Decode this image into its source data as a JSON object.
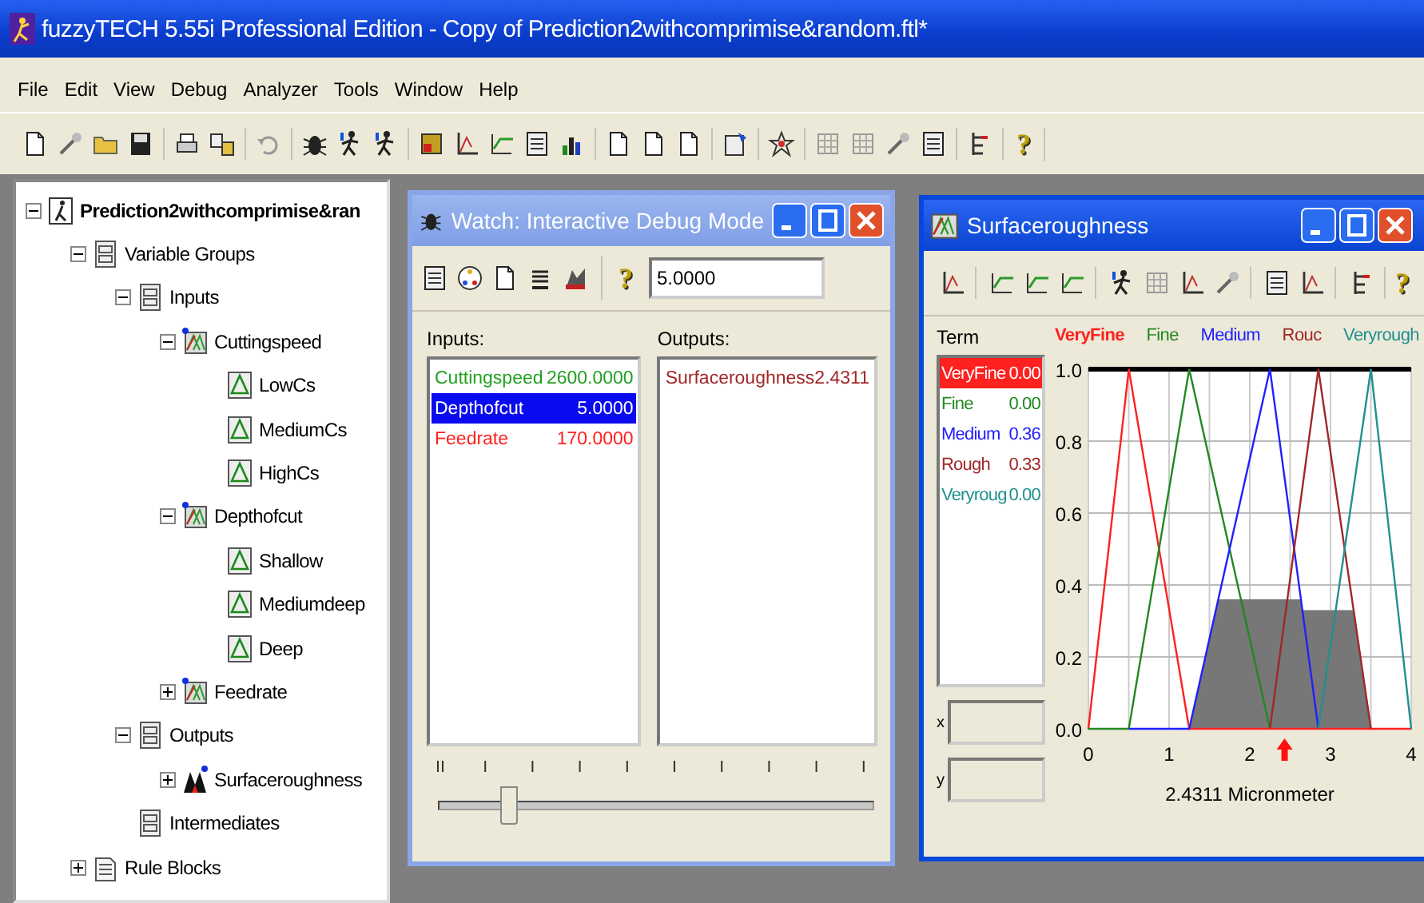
{
  "window": {
    "title": "fuzzyTECH 5.55i Professional Edition - Copy of Prediction2withcomprimise&random.ftl*"
  },
  "menu": [
    "File",
    "Edit",
    "View",
    "Debug",
    "Analyzer",
    "Tools",
    "Window",
    "Help"
  ],
  "toolbar": {
    "help": "?"
  },
  "tree": [
    {
      "label": "Prediction2withcomprimise&ran",
      "kind": "project",
      "expanded": true,
      "children": [
        {
          "label": "Variable Groups",
          "kind": "group",
          "expanded": true,
          "children": [
            {
              "label": "Inputs",
              "kind": "group",
              "expanded": true,
              "children": [
                {
                  "label": "Cuttingspeed",
                  "kind": "input",
                  "expanded": true,
                  "children": [
                    {
                      "label": "LowCs",
                      "kind": "term"
                    },
                    {
                      "label": "MediumCs",
                      "kind": "term"
                    },
                    {
                      "label": "HighCs",
                      "kind": "term"
                    }
                  ]
                },
                {
                  "label": "Depthofcut",
                  "kind": "input",
                  "expanded": true,
                  "children": [
                    {
                      "label": "Shallow",
                      "kind": "term"
                    },
                    {
                      "label": "Mediumdeep",
                      "kind": "term"
                    },
                    {
                      "label": "Deep",
                      "kind": "term"
                    }
                  ]
                },
                {
                  "label": "Feedrate",
                  "kind": "input",
                  "expanded": false
                }
              ]
            },
            {
              "label": "Outputs",
              "kind": "group",
              "expanded": true,
              "children": [
                {
                  "label": "Surfaceroughness",
                  "kind": "output",
                  "expanded": false
                }
              ]
            },
            {
              "label": "Intermediates",
              "kind": "group"
            }
          ]
        },
        {
          "label": "Rule Blocks",
          "kind": "rules",
          "expanded": false
        }
      ]
    }
  ],
  "watch": {
    "title": "Watch: Interactive Debug Mode",
    "help": "?",
    "value": "5.0000",
    "inputs_label": "Inputs:",
    "outputs_label": "Outputs:",
    "inputs": [
      {
        "name": "Cuttingspeed",
        "value": "2600.0000",
        "color": "#22a022",
        "selected": false
      },
      {
        "name": "Depthofcut",
        "value": "5.0000",
        "selected": true
      },
      {
        "name": "Feedrate",
        "value": "170.0000",
        "color": "#ff2020",
        "selected": false
      }
    ],
    "outputs": [
      {
        "name": "Surfaceroughness",
        "value": "2.4311",
        "color": "#a02828",
        "selected": false
      }
    ],
    "slider": {
      "level": 0.14
    }
  },
  "surface": {
    "title": "Surfaceroughness",
    "help": "?",
    "term_label": "Term",
    "x_label": "x",
    "y_label": "y",
    "terms": [
      {
        "name": "VeryFine",
        "value": "0.00",
        "color": "#ff2020",
        "selected": true
      },
      {
        "name": "Fine",
        "value": "0.00",
        "color": "#228822",
        "selected": false
      },
      {
        "name": "Medium",
        "value": "0.36",
        "color": "#2020ff",
        "selected": false
      },
      {
        "name": "Rough",
        "value": "0.33",
        "color": "#a02828",
        "selected": false
      },
      {
        "name": "Veryroug",
        "value": "0.00",
        "color": "#209090",
        "selected": false
      }
    ],
    "chart_data": {
      "type": "line",
      "grid": true,
      "xlabel": "2.4311 Micronmeter",
      "x": [
        0,
        0.5,
        1.25,
        2.25,
        2.85,
        3.5,
        4
      ],
      "xlim": [
        0,
        4
      ],
      "ylim": [
        0,
        1
      ],
      "xticks": [
        0,
        1,
        2,
        3,
        4
      ],
      "yticks": [
        {
          "value": 0,
          "label": "0.0"
        },
        {
          "value": 0.2,
          "label": "0.2"
        },
        {
          "value": 0.4,
          "label": "0.4"
        },
        {
          "value": 0.6,
          "label": "0.6"
        },
        {
          "value": 0.8,
          "label": "0.8"
        },
        {
          "value": 1,
          "label": "1.0"
        }
      ],
      "series": [
        {
          "name": "VeryFine",
          "color": "#ff2020",
          "values": [
            0,
            1,
            0,
            0,
            0,
            0,
            0
          ]
        },
        {
          "name": "Fine",
          "color": "#228822",
          "values": [
            0,
            0,
            1,
            0,
            null,
            null,
            null
          ]
        },
        {
          "name": "Medium",
          "color": "#2020ff",
          "values": [
            null,
            0,
            0,
            1,
            0,
            null,
            null
          ]
        },
        {
          "name": "Rouc",
          "color": "#a02828",
          "values": [
            null,
            null,
            null,
            0,
            1,
            0,
            null
          ]
        },
        {
          "name": "Veryrough",
          "color": "#209090",
          "values": [
            null,
            null,
            null,
            null,
            0,
            1,
            0
          ]
        }
      ]
    }
  }
}
